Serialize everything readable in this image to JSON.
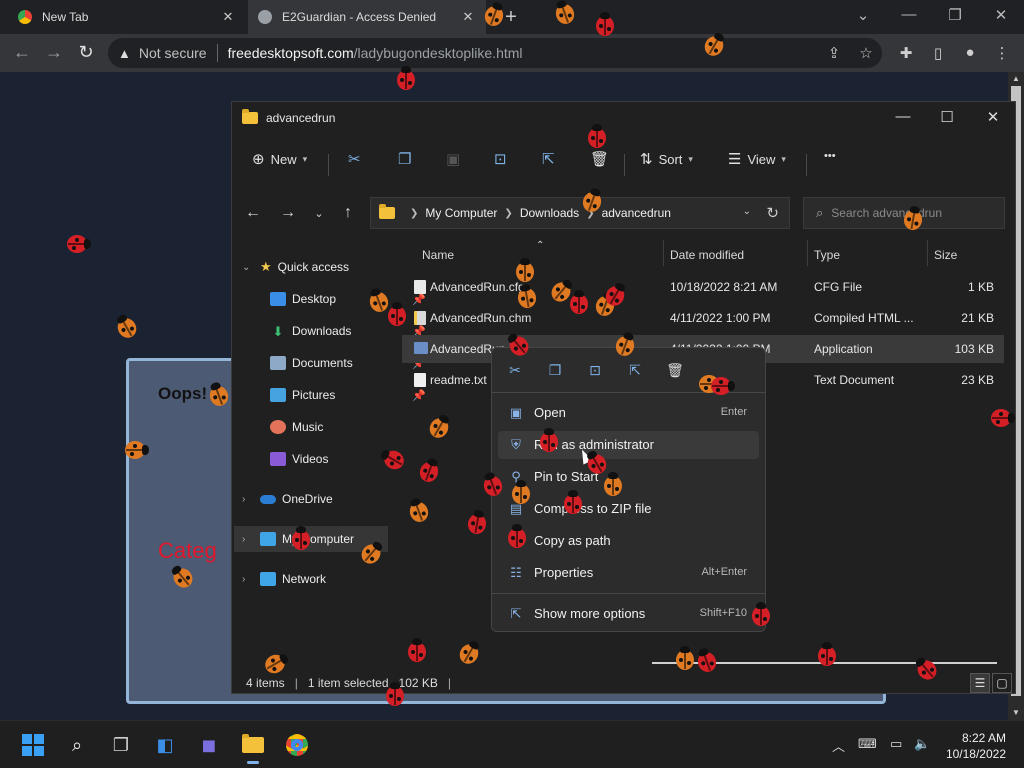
{
  "browser": {
    "tabs": [
      {
        "title": "New Tab",
        "close": "✕"
      },
      {
        "title": "E2Guardian - Access Denied",
        "close": "✕"
      }
    ],
    "new_tab": "+",
    "window_controls": {
      "minimize": "—",
      "restore": "❐",
      "close": "✕"
    },
    "nav": {
      "back": "←",
      "forward": "→",
      "reload": "↻"
    },
    "address": {
      "security": "Not secure",
      "host": "freedesktopsoft.com",
      "path": "/ladybugondesktoplike.html"
    },
    "toolbar_icons": [
      "share-icon",
      "star-icon",
      "extensions-icon",
      "sidepanel-icon",
      "profile-icon",
      "menu-icon"
    ]
  },
  "page": {
    "oops": "Oops!",
    "category": "Categ"
  },
  "explorer": {
    "title": "advancedrun",
    "window_controls": {
      "minimize": "—",
      "maximize": "☐",
      "close": "✕"
    },
    "commands": {
      "new": "New",
      "sort": "Sort",
      "view": "View",
      "more": "•••"
    },
    "breadcrumb": [
      "My Computer",
      "Downloads",
      "advancedrun"
    ],
    "search_placeholder": "Search advancedrun",
    "nav": {
      "quick_access": "Quick access",
      "items": [
        {
          "label": "Desktop"
        },
        {
          "label": "Downloads"
        },
        {
          "label": "Documents"
        },
        {
          "label": "Pictures"
        },
        {
          "label": "Music"
        },
        {
          "label": "Videos"
        }
      ],
      "onedrive": "OneDrive",
      "my_computer": "My Computer",
      "network": "Network"
    },
    "columns": {
      "name": "Name",
      "date": "Date modified",
      "type": "Type",
      "size": "Size"
    },
    "files": [
      {
        "name": "AdvancedRun.cfg",
        "date": "10/18/2022 8:21 AM",
        "type": "CFG File",
        "size": "1 KB"
      },
      {
        "name": "AdvancedRun.chm",
        "date": "4/11/2022 1:00 PM",
        "type": "Compiled HTML ...",
        "size": "21 KB"
      },
      {
        "name": "AdvancedRun.exe",
        "date": "4/11/2022 1:00 PM",
        "type": "Application",
        "size": "103 KB"
      },
      {
        "name": "readme.txt",
        "date": "",
        "type": "Text Document",
        "size": "23 KB"
      }
    ],
    "status": {
      "items": "4 items",
      "selected": "1 item selected",
      "size": "102 KB"
    }
  },
  "context_menu": {
    "quick_actions": [
      "cut-icon",
      "copy-icon",
      "rename-icon",
      "share-icon",
      "delete-icon"
    ],
    "items": [
      {
        "label": "Open",
        "shortcut": "Enter"
      },
      {
        "label": "Run as administrator",
        "shortcut": ""
      },
      {
        "label": "Pin to Start",
        "shortcut": ""
      },
      {
        "label": "Compress to ZIP file",
        "shortcut": ""
      },
      {
        "label": "Copy as path",
        "shortcut": ""
      },
      {
        "label": "Properties",
        "shortcut": "Alt+Enter"
      },
      {
        "label": "Show more options",
        "shortcut": "Shift+F10"
      }
    ]
  },
  "taskbar": {
    "apps": [
      "start-icon",
      "search-icon",
      "task-view-icon",
      "widgets-icon",
      "chat-icon",
      "file-explorer-icon",
      "chrome-icon"
    ],
    "time": "8:22 AM",
    "date": "10/18/2022"
  },
  "colors": {
    "accent": "#7fb2e6",
    "ladybug_red": "#d41f26",
    "ladybug_orange": "#e07a22",
    "category_red": "#e0162b"
  }
}
